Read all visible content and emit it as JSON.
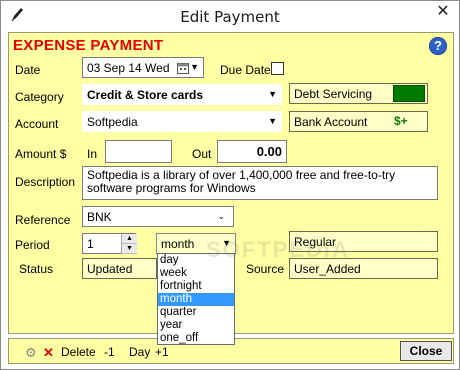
{
  "window": {
    "title": "Edit Payment",
    "close_glyph": "✕"
  },
  "header": {
    "heading": "EXPENSE PAYMENT",
    "help_glyph": "?"
  },
  "date": {
    "label": "Date",
    "value": "03 Sep 14 Wed",
    "due_label": "Due Date"
  },
  "category": {
    "label": "Category",
    "value": "Credit & Store cards",
    "group": "Debt Servicing"
  },
  "account": {
    "label": "Account",
    "value": "Softpedia",
    "linked": "Bank Account",
    "icon_text": "$+"
  },
  "amount": {
    "label": "Amount $",
    "in_label": "In",
    "in_value": "",
    "out_label": "Out",
    "out_value": "0.00"
  },
  "description": {
    "label": "Description",
    "value": "Softpedia is a library of over 1,400,000 free and free-to-try software programs for Windows"
  },
  "reference": {
    "label": "Reference",
    "value": "BNK"
  },
  "period": {
    "label": "Period",
    "count": "1",
    "unit": "month",
    "schedule": "Regular",
    "options": [
      "day",
      "week",
      "fortnight",
      "month",
      "quarter",
      "year",
      "one_off"
    ],
    "selected": "month"
  },
  "status": {
    "label": "Status",
    "value": "Updated",
    "source_label": "Source",
    "source_value": "User_Added"
  },
  "bottom": {
    "delete_label": "Delete",
    "minus_label": "-1",
    "day_label": "Day",
    "plus_label": "+1",
    "close_label": "Close"
  },
  "watermark": "SOFTPEDIA",
  "colors": {
    "panel": "#ffffa3",
    "heading": "#e60000",
    "status_green": "#007a00",
    "highlight": "#3399ff"
  }
}
